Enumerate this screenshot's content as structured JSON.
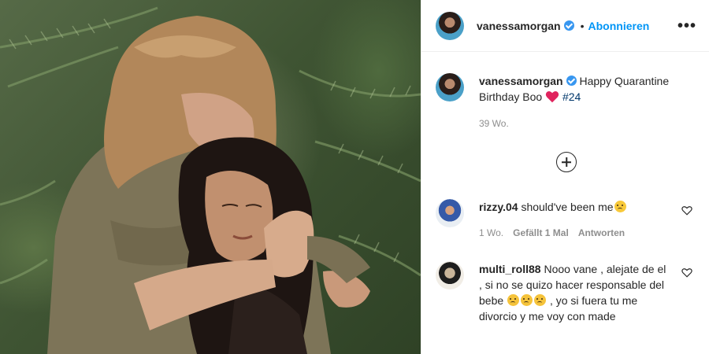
{
  "post": {
    "author": "vanessamorgan",
    "follow_label": "Abonnieren",
    "bullet": "•",
    "more_label": "•••"
  },
  "caption": {
    "username": "vanessamorgan",
    "text_before": "Happy Quarantine Birthday Boo",
    "text_after": "#24",
    "time": "39 Wo."
  },
  "comments": [
    {
      "username": "rizzy.04",
      "text": "should've been me",
      "emoji": "sweat-smile-emoji",
      "time": "1 Wo.",
      "likes_label": "Gefällt 1 Mal",
      "reply_label": "Antworten"
    },
    {
      "username": "multi_roll88",
      "text_part1": "Nooo vane , alejate de el , si no se quizo hacer responsable del bebe",
      "emojis": [
        "sad-emoji",
        "sad-emoji",
        "sad-emoji"
      ],
      "text_part2": ", yo si fuera tu me divorcio y me voy con made"
    }
  ],
  "icons": {
    "verified": "verified-badge-icon",
    "heart": "red-heart-emoji",
    "load_more": "plus-circle-icon",
    "like": "heart-outline-icon"
  },
  "colors": {
    "accent": "#0095f6",
    "verified": "#3897f0",
    "heart": "#e0245e",
    "muted": "#8e8e8e",
    "text": "#262626"
  }
}
